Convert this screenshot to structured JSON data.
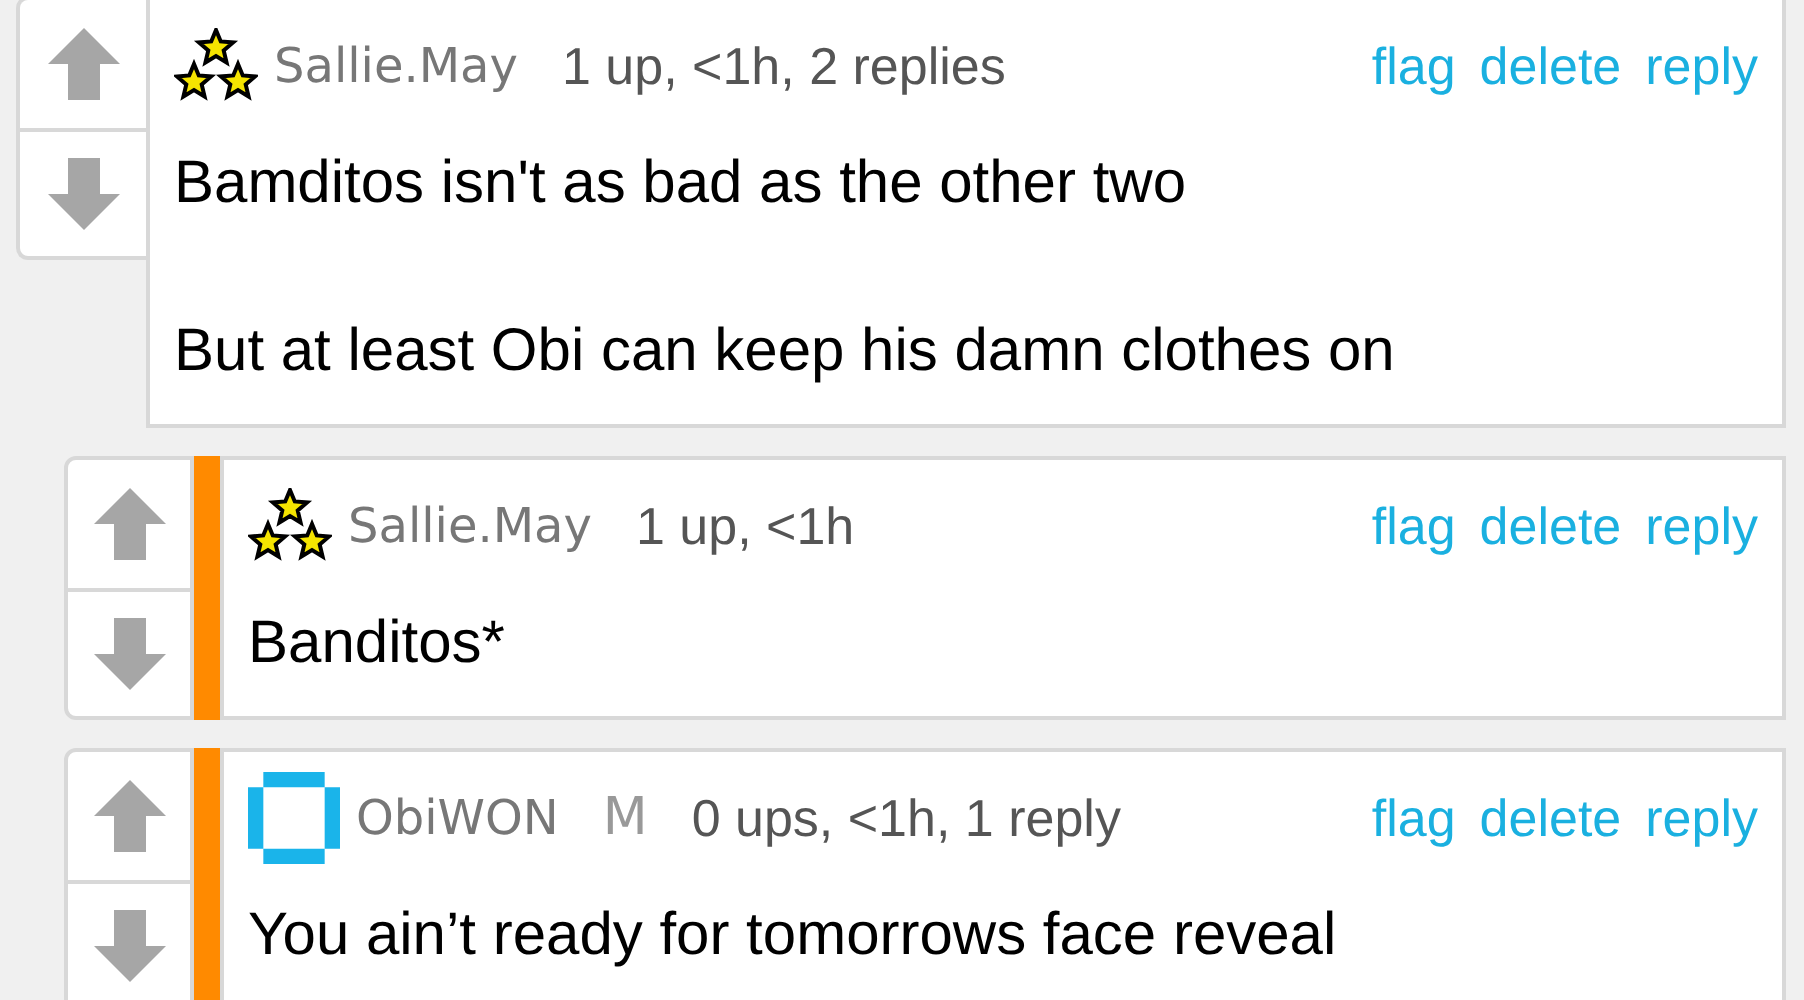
{
  "comments": [
    {
      "kind": "stars",
      "username": "Sallie.May",
      "meta": "1 up, <1h, 2 replies",
      "actions": [
        "flag",
        "delete",
        "reply"
      ],
      "paragraphs": [
        "Bamditos isn't as bad as the other two",
        "But at least Obi can keep his damn clothes on"
      ],
      "children": [
        {
          "kind": "stars",
          "username": "Sallie.May",
          "meta": "1 up, <1h",
          "actions": [
            "flag",
            "delete",
            "reply"
          ],
          "paragraphs": [
            "Banditos*"
          ]
        },
        {
          "kind": "square",
          "username": "ObiWON",
          "tag": "M",
          "meta": "0 ups, <1h, 1 reply",
          "actions": [
            "flag",
            "delete",
            "reply"
          ],
          "paragraphs": [
            "You ain’t ready for tomorrows face reveal"
          ]
        }
      ]
    }
  ]
}
